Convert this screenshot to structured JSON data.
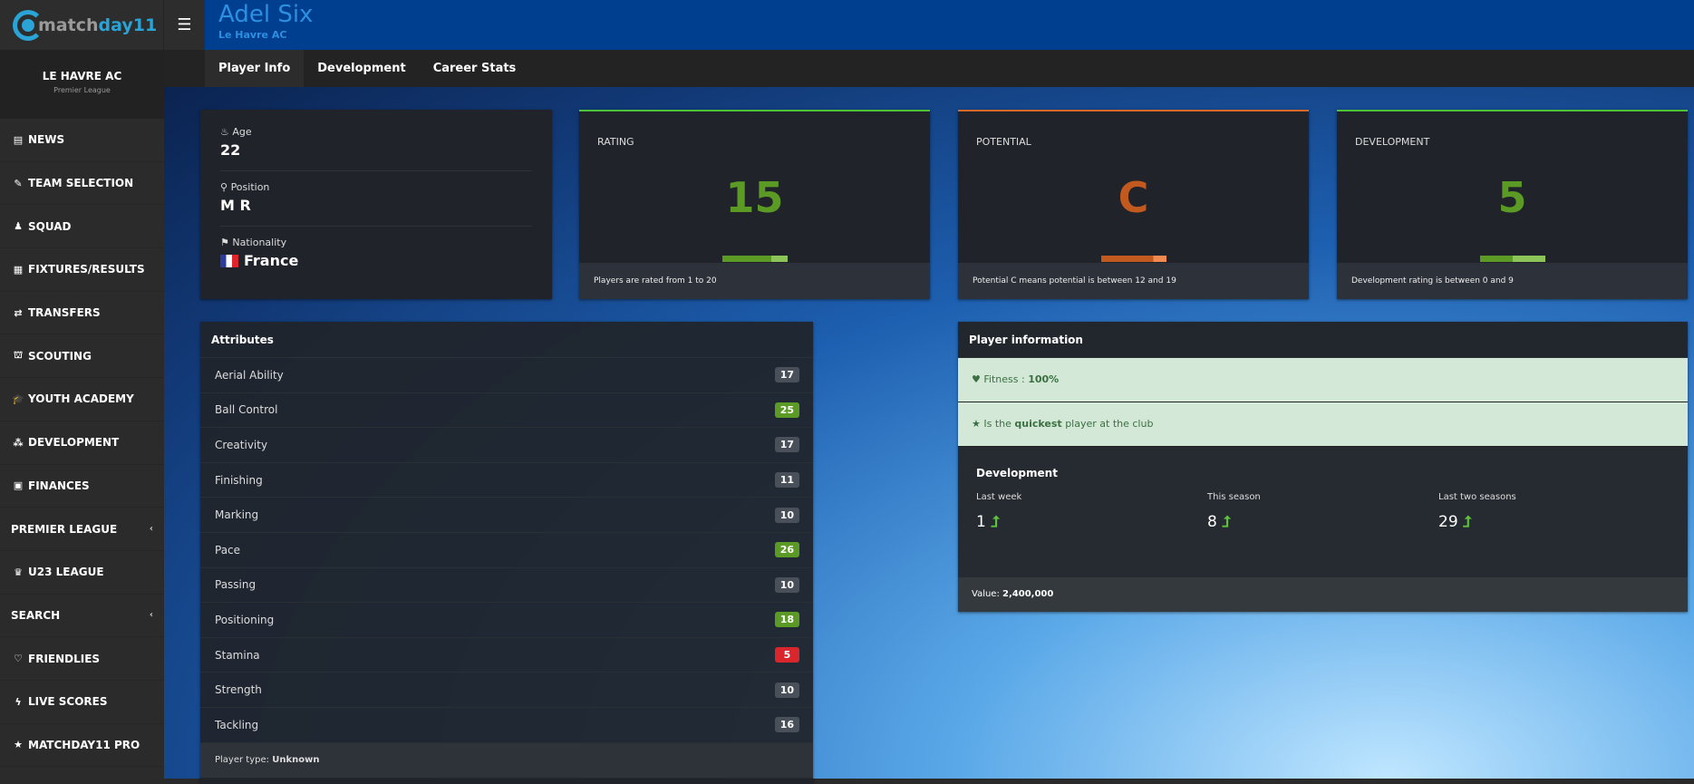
{
  "app": {
    "logo_text_a": "match",
    "logo_text_b": "day11"
  },
  "club": {
    "name": "LE HAVRE AC",
    "league": "Premier League"
  },
  "sidebar": {
    "items": [
      {
        "label": "NEWS",
        "icon": "newspaper-icon",
        "glyph": "▤"
      },
      {
        "label": "TEAM SELECTION",
        "icon": "pencil-icon",
        "glyph": "✎"
      },
      {
        "label": "SQUAD",
        "icon": "person-icon",
        "glyph": "♟"
      },
      {
        "label": "FIXTURES/RESULTS",
        "icon": "calendar-icon",
        "glyph": "▦"
      },
      {
        "label": "TRANSFERS",
        "icon": "exchange-icon",
        "glyph": "⇄"
      },
      {
        "label": "SCOUTING",
        "icon": "binoculars-icon",
        "glyph": "⛫"
      },
      {
        "label": "YOUTH ACADEMY",
        "icon": "graduation-cap-icon",
        "glyph": "🎓"
      },
      {
        "label": "DEVELOPMENT",
        "icon": "cubes-icon",
        "glyph": "⁂"
      },
      {
        "label": "FINANCES",
        "icon": "money-icon",
        "glyph": "▣"
      },
      {
        "label": "PREMIER LEAGUE",
        "icon": "",
        "glyph": "",
        "chevron": "‹"
      },
      {
        "label": "U23 LEAGUE",
        "icon": "trophy-icon",
        "glyph": "♛"
      },
      {
        "label": "SEARCH",
        "icon": "",
        "glyph": "",
        "chevron": "‹"
      },
      {
        "label": "FRIENDLIES",
        "icon": "handshake-icon",
        "glyph": "♡"
      },
      {
        "label": "LIVE SCORES",
        "icon": "bolt-icon",
        "glyph": "ϟ"
      },
      {
        "label": "MATCHDAY11 PRO",
        "icon": "star-icon",
        "glyph": "★"
      }
    ]
  },
  "header": {
    "player_name": "Adel Six",
    "club": "Le Havre AC"
  },
  "tabs": [
    {
      "label": "Player Info"
    },
    {
      "label": "Development"
    },
    {
      "label": "Career Stats"
    }
  ],
  "info": {
    "age_label": "Age",
    "age": "22",
    "position_label": "Position",
    "position": "M R",
    "nationality_label": "Nationality",
    "nationality": "France"
  },
  "stats": [
    {
      "title": "RATING",
      "value": "15",
      "color": "#5a9a25",
      "bar_fraction": 0.75,
      "footer": "Players are rated from 1 to 20"
    },
    {
      "title": "POTENTIAL",
      "value": "C",
      "color": "#c25a1f",
      "bar_fraction": 0.8,
      "footer": "Potential C means potential is between 12 and 19"
    },
    {
      "title": "DEVELOPMENT",
      "value": "5",
      "color": "#5a9a25",
      "bar_fraction": 0.5,
      "footer": "Development rating is between 0 and 9"
    }
  ],
  "attributes": {
    "title": "Attributes",
    "items": [
      {
        "name": "Aerial Ability",
        "value": "17",
        "color": "#4a5059"
      },
      {
        "name": "Ball Control",
        "value": "25",
        "color": "#5a9a25"
      },
      {
        "name": "Creativity",
        "value": "17",
        "color": "#4a5059"
      },
      {
        "name": "Finishing",
        "value": "11",
        "color": "#4a5059"
      },
      {
        "name": "Marking",
        "value": "10",
        "color": "#4a5059"
      },
      {
        "name": "Pace",
        "value": "26",
        "color": "#5a9a25"
      },
      {
        "name": "Passing",
        "value": "10",
        "color": "#4a5059"
      },
      {
        "name": "Positioning",
        "value": "18",
        "color": "#5a9a25"
      },
      {
        "name": "Stamina",
        "value": "5",
        "color": "#d9262c"
      },
      {
        "name": "Strength",
        "value": "10",
        "color": "#4a5059"
      },
      {
        "name": "Tackling",
        "value": "16",
        "color": "#4a5059"
      }
    ],
    "footer_label": "Player type:",
    "footer_value": "Unknown"
  },
  "player_information": {
    "title": "Player information",
    "fitness_label": "Fitness :",
    "fitness": "100%",
    "quick_pre": "Is the",
    "quick_bold": "quickest",
    "quick_post": "player at the club",
    "dev_title": "Development",
    "dev": [
      {
        "label": "Last week",
        "value": "1"
      },
      {
        "label": "This season",
        "value": "8"
      },
      {
        "label": "Last two seasons",
        "value": "29"
      }
    ],
    "value_label": "Value:",
    "value": "2,400,000"
  }
}
